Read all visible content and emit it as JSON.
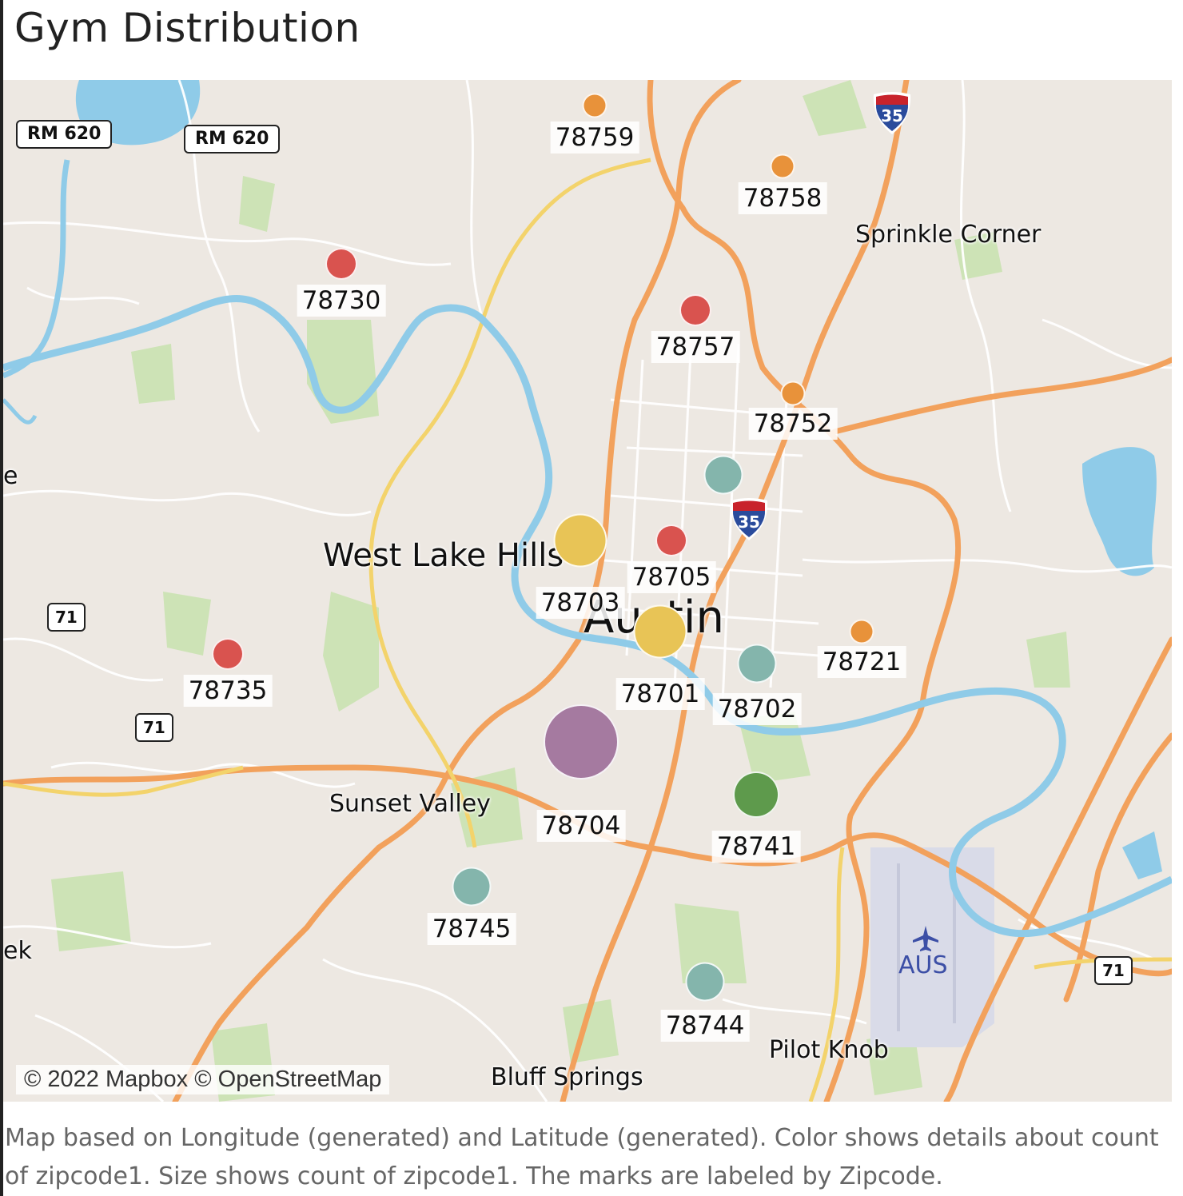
{
  "title": "Gym Distribution",
  "map": {
    "road_shields": [
      "RM 620",
      "RM 620",
      "71",
      "71",
      "71"
    ],
    "interstate_shields": [
      "35",
      "35"
    ],
    "places": [
      "West Lake Hills",
      "Austin",
      "Sunset Valley",
      "Sprinkle Corner",
      "Pilot Knob",
      "Bluff Springs"
    ],
    "edge_fragments": [
      "e",
      "ek"
    ],
    "airport": "AUS",
    "attribution": "© 2022 Mapbox © OpenStreetMap"
  },
  "chart_data": {
    "type": "scatter",
    "encoding": "Color shows count of zipcode1; size shows count of zipcode1",
    "colors": {
      "red": "#d9534f",
      "orange": "#e8923a",
      "teal": "#84b5ac",
      "yellow": "#e8c456",
      "purple": "#a57aa0",
      "green": "#5e9a4c"
    },
    "marks": [
      {
        "zipcode": "78759",
        "color": "#e8923a",
        "size": 1
      },
      {
        "zipcode": "78758",
        "color": "#e8923a",
        "size": 1
      },
      {
        "zipcode": "78730",
        "color": "#d9534f",
        "size": 2
      },
      {
        "zipcode": "78757",
        "color": "#d9534f",
        "size": 2
      },
      {
        "zipcode": "78752",
        "color": "#e8923a",
        "size": 1
      },
      {
        "zipcode": "",
        "color": "#84b5ac",
        "size": 3
      },
      {
        "zipcode": "78703",
        "color": "#e8c456",
        "size": 5
      },
      {
        "zipcode": "78705",
        "color": "#d9534f",
        "size": 2
      },
      {
        "zipcode": "78701",
        "color": "#e8c456",
        "size": 5
      },
      {
        "zipcode": "78702",
        "color": "#84b5ac",
        "size": 3
      },
      {
        "zipcode": "78721",
        "color": "#e8923a",
        "size": 1
      },
      {
        "zipcode": "78735",
        "color": "#d9534f",
        "size": 2
      },
      {
        "zipcode": "78704",
        "color": "#a57aa0",
        "size": 8
      },
      {
        "zipcode": "78741",
        "color": "#5e9a4c",
        "size": 4
      },
      {
        "zipcode": "78745",
        "color": "#84b5ac",
        "size": 3
      },
      {
        "zipcode": "78744",
        "color": "#84b5ac",
        "size": 3
      }
    ]
  },
  "caption": "Map based on Longitude (generated) and Latitude (generated).  Color shows details about count of zipcode1.  Size shows count of zipcode1.  The marks are labeled by Zipcode."
}
